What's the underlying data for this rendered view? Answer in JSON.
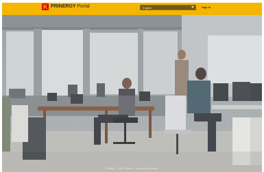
{
  "header": {
    "logo_letter": "K",
    "brand_bold": "PRINERGY",
    "brand_light": "Portal",
    "language_value": "English",
    "sign_in_label": "Sign In"
  },
  "footer": {
    "links": [
      "Privacy",
      "Site Terms",
      "Contact Information"
    ]
  },
  "colors": {
    "accent": "#f5b500",
    "brand_red": "#e3000f"
  }
}
